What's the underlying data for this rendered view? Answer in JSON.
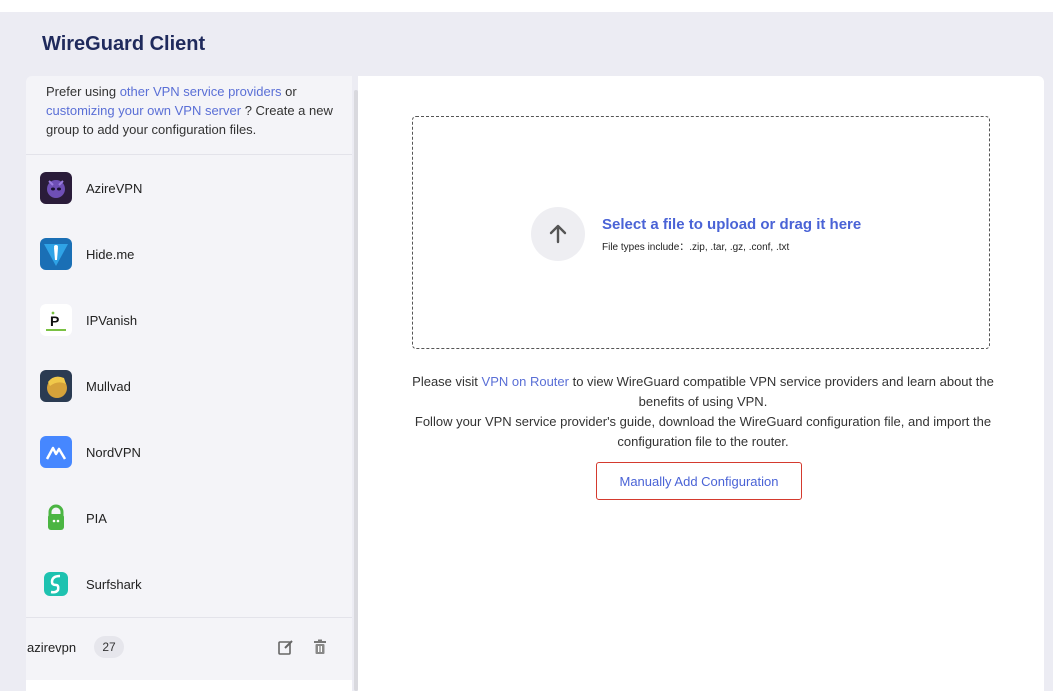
{
  "app": {
    "title": "WireGuard Client"
  },
  "sidebar": {
    "promo": {
      "prefix": "Prefer using ",
      "link1": "other VPN service providers",
      "mid": " or ",
      "link2": "customizing your own VPN server",
      "suffix": " ? Create a new group to add your configuration files."
    },
    "providers": [
      {
        "name": "AzireVPN",
        "icon": "azirevpn-logo-icon",
        "color": "#2a1c3a"
      },
      {
        "name": "Hide.me",
        "icon": "hideme-logo-icon",
        "color": "#1a6fb5"
      },
      {
        "name": "IPVanish",
        "icon": "ipvanish-logo-icon",
        "color": "#ffffff"
      },
      {
        "name": "Mullvad",
        "icon": "mullvad-logo-icon",
        "color": "#2b3b52"
      },
      {
        "name": "NordVPN",
        "icon": "nordvpn-logo-icon",
        "color": "#4687ff"
      },
      {
        "name": "PIA",
        "icon": "pia-logo-icon",
        "color": "#4bb543"
      },
      {
        "name": "Surfshark",
        "icon": "surfshark-logo-icon",
        "color": "#1ec2b0"
      }
    ],
    "group": {
      "name": "azirevpn",
      "count": "27"
    }
  },
  "upload": {
    "title": "Select a file to upload or drag it here",
    "subtitle": "File types include：.zip, .tar, .gz, .conf, .txt"
  },
  "info": {
    "line1_prefix": "Please visit ",
    "line1_link": "VPN on Router",
    "line1_suffix": " to view WireGuard compatible VPN service providers and learn about the benefits of using VPN.",
    "line2": "Follow your VPN service provider's guide, download the WireGuard configuration file, and import the configuration file to the router."
  },
  "manual_button": "Manually Add Configuration",
  "colors": {
    "accent": "#4a63d6",
    "link": "#5a6fd6",
    "title": "#1f2a5c",
    "highlight_border": "#d43a2e"
  }
}
